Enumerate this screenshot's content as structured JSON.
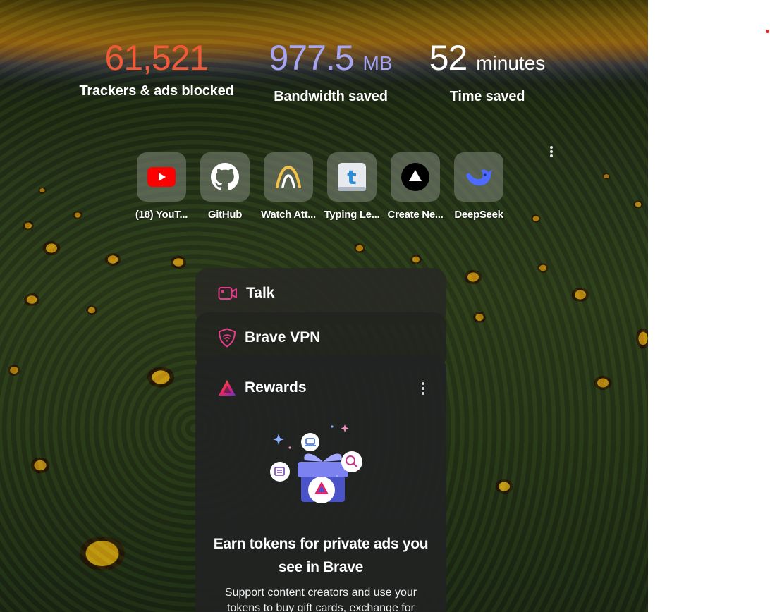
{
  "stats": {
    "trackers": {
      "value": "61,521",
      "label": "Trackers & ads blocked",
      "color": "#f05a36"
    },
    "bandwidth": {
      "value": "977.5",
      "unit": "MB",
      "label": "Bandwidth saved",
      "color": "#a7a5f2"
    },
    "time": {
      "value": "52",
      "unit": "minutes",
      "label": "Time saved",
      "color": "#ffffff"
    }
  },
  "top_sites": [
    {
      "label": "(18) YouT...",
      "icon": "youtube-icon"
    },
    {
      "label": "GitHub",
      "icon": "github-icon"
    },
    {
      "label": "Watch Att...",
      "icon": "watch-logo-icon"
    },
    {
      "label": "Typing Le...",
      "icon": "typing-t-icon"
    },
    {
      "label": "Create Ne...",
      "icon": "triangle-logo-icon"
    },
    {
      "label": "DeepSeek",
      "icon": "deepseek-whale-icon"
    }
  ],
  "widgets": {
    "talk": {
      "title": "Talk",
      "icon": "video-camera-icon",
      "accent": "#e83b8e"
    },
    "vpn": {
      "title": "Brave VPN",
      "icon": "shield-icon",
      "accent": "#e83b8e"
    },
    "rewards": {
      "title": "Rewards",
      "icon": "brave-rewards-triangle-icon",
      "heading": "Earn tokens for private ads you see in Brave",
      "description": "Support content creators and use your tokens to buy gift cards, exchange for"
    }
  }
}
